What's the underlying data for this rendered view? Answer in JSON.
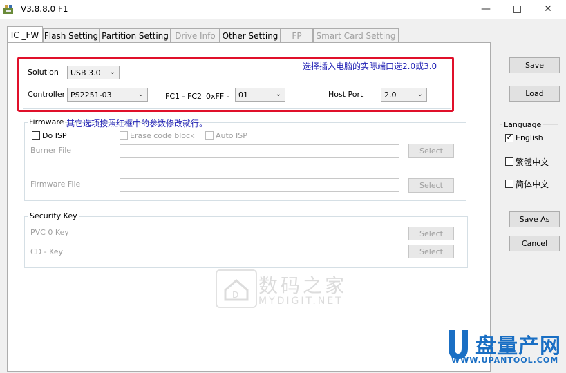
{
  "window": {
    "title": "V3.8.8.0 F1"
  },
  "tabs": [
    {
      "label": "IC _FW",
      "active": true,
      "enabled": true
    },
    {
      "label": "Flash Setting",
      "active": false,
      "enabled": true
    },
    {
      "label": "Partition Setting",
      "active": false,
      "enabled": true
    },
    {
      "label": "Drive Info",
      "active": false,
      "enabled": false
    },
    {
      "label": "Other Setting",
      "active": false,
      "enabled": true
    },
    {
      "label": "FP",
      "active": false,
      "enabled": false
    },
    {
      "label": "Smart Card Setting",
      "active": false,
      "enabled": false
    }
  ],
  "config": {
    "solution_label": "Solution",
    "solution_value": "USB 3.0",
    "controller_label": "Controller",
    "controller_value": "PS2251-03",
    "fc_label": "FC1 - FC2",
    "fc_prefix": "0xFF -",
    "fc_value": "01",
    "hostport_label": "Host Port",
    "hostport_value": "2.0"
  },
  "annotations": {
    "top": "选择插入电脑的实际端口选2.0或3.0",
    "firmware": "其它选项按照红框中的参数修改就行。"
  },
  "firmware": {
    "legend": "Firmware",
    "do_isp": "Do ISP",
    "erase_code_block": "Erase code block",
    "auto_isp": "Auto ISP",
    "burner_file_label": "Burner File",
    "firmware_file_label": "Firmware File",
    "select_label": "Select"
  },
  "security": {
    "legend": "Security Key",
    "pvc_label": "PVC 0 Key",
    "cd_label": "CD - Key",
    "select_label": "Select"
  },
  "side": {
    "save": "Save",
    "load": "Load",
    "language_legend": "Language",
    "lang_english": "English",
    "lang_trad": "繁體中文",
    "lang_simp": "简体中文",
    "english_checked": true,
    "save_as": "Save As",
    "cancel": "Cancel"
  },
  "watermarks": {
    "mydigit_cn": "数码之家",
    "mydigit_en": "MYDIGIT.NET",
    "upan_cn": "盘量产网",
    "upan_url": "WWW.UPANTOOL.COM"
  },
  "colors": {
    "accent_red": "#e0102a",
    "annotation_blue": "#2323b5",
    "upan_blue": "#1a6fc4"
  }
}
